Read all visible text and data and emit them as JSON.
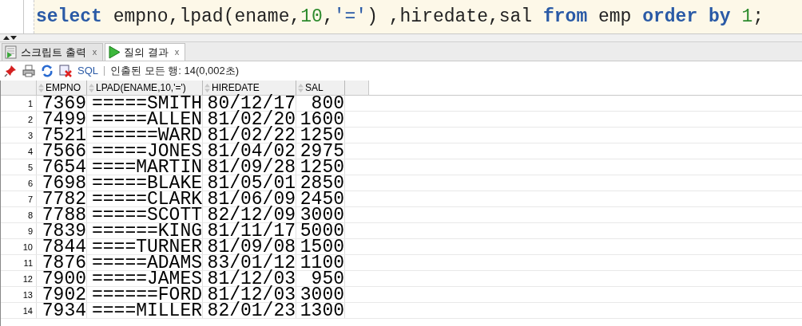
{
  "editor": {
    "tokens": [
      {
        "text": "select",
        "kind": "keyword"
      },
      {
        "text": " empno,lpad(ename,",
        "kind": "plain"
      },
      {
        "text": "10",
        "kind": "number"
      },
      {
        "text": ",",
        "kind": "plain"
      },
      {
        "text": "'='",
        "kind": "string"
      },
      {
        "text": ") ,hiredate,sal ",
        "kind": "plain"
      },
      {
        "text": "from",
        "kind": "keyword"
      },
      {
        "text": " emp ",
        "kind": "plain"
      },
      {
        "text": "order by ",
        "kind": "keyword"
      },
      {
        "text": "1",
        "kind": "number"
      },
      {
        "text": ";",
        "kind": "plain"
      }
    ]
  },
  "tabs": [
    {
      "label": "스크립트 출력",
      "close": "x",
      "selected": false
    },
    {
      "label": "질의 결과",
      "close": "x",
      "selected": true
    }
  ],
  "toolbar": {
    "sql_link": "SQL",
    "status": "인출된 모든 행: 14(0,002초)"
  },
  "table": {
    "columns": [
      "",
      "EMPNO",
      "LPAD(ENAME,10,'=')",
      "HIREDATE",
      "SAL"
    ],
    "rows": [
      [
        "1",
        "7369",
        "=====SMITH",
        "80/12/17",
        "800"
      ],
      [
        "2",
        "7499",
        "=====ALLEN",
        "81/02/20",
        "1600"
      ],
      [
        "3",
        "7521",
        "======WARD",
        "81/02/22",
        "1250"
      ],
      [
        "4",
        "7566",
        "=====JONES",
        "81/04/02",
        "2975"
      ],
      [
        "5",
        "7654",
        "====MARTIN",
        "81/09/28",
        "1250"
      ],
      [
        "6",
        "7698",
        "=====BLAKE",
        "81/05/01",
        "2850"
      ],
      [
        "7",
        "7782",
        "=====CLARK",
        "81/06/09",
        "2450"
      ],
      [
        "8",
        "7788",
        "=====SCOTT",
        "82/12/09",
        "3000"
      ],
      [
        "9",
        "7839",
        "======KING",
        "81/11/17",
        "5000"
      ],
      [
        "10",
        "7844",
        "====TURNER",
        "81/09/08",
        "1500"
      ],
      [
        "11",
        "7876",
        "=====ADAMS",
        "83/01/12",
        "1100"
      ],
      [
        "12",
        "7900",
        "=====JAMES",
        "81/12/03",
        "950"
      ],
      [
        "13",
        "7902",
        "======FORD",
        "81/12/03",
        "3000"
      ],
      [
        "14",
        "7934",
        "====MILLER",
        "82/01/23",
        "1300"
      ]
    ]
  }
}
